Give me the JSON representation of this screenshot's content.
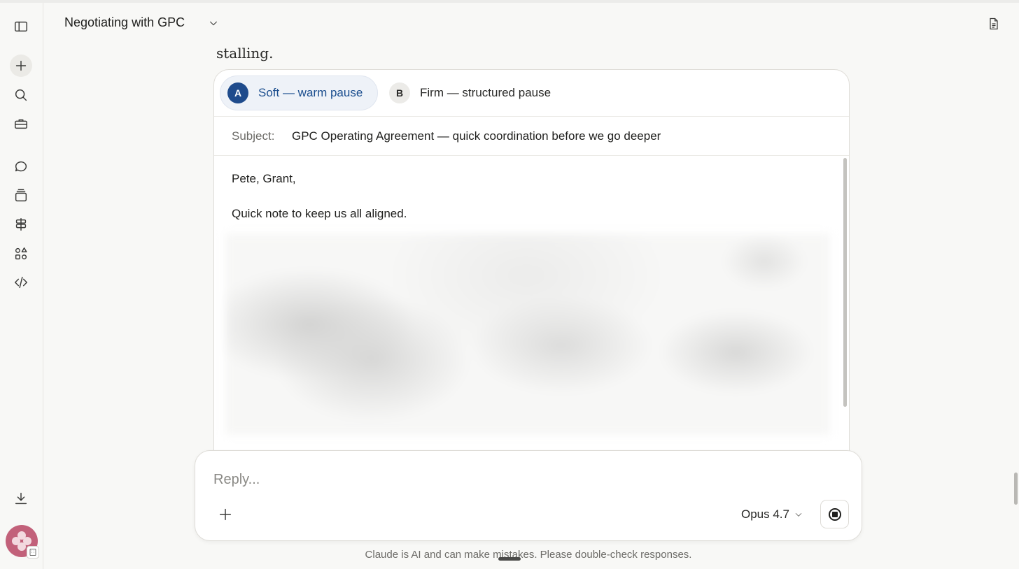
{
  "header": {
    "title": "Negotiating with GPC"
  },
  "sidebar": {
    "items": [
      {
        "name": "toggle-sidebar",
        "icon": "sidebar-icon"
      },
      {
        "name": "new-chat",
        "icon": "plus-icon"
      },
      {
        "name": "search",
        "icon": "search-icon"
      },
      {
        "name": "tools",
        "icon": "toolbox-icon"
      },
      {
        "name": "chats",
        "icon": "chat-icon"
      },
      {
        "name": "projects",
        "icon": "stack-icon"
      },
      {
        "name": "artifacts",
        "icon": "signpost-icon"
      },
      {
        "name": "apps",
        "icon": "shapes-icon"
      },
      {
        "name": "code",
        "icon": "code-icon"
      },
      {
        "name": "download",
        "icon": "download-icon"
      }
    ]
  },
  "message": {
    "trailing_text": "stalling."
  },
  "email": {
    "tabs": [
      {
        "letter": "A",
        "label": "Soft — warm pause",
        "selected": true
      },
      {
        "letter": "B",
        "label": "Firm — structured pause",
        "selected": false
      }
    ],
    "subject_label": "Subject:",
    "subject": "GPC Operating Agreement — quick coordination before we go deeper",
    "greeting": "Pete, Grant,",
    "line1": "Quick note to keep us all aligned."
  },
  "composer": {
    "placeholder": "Reply...",
    "model": "Opus 4.7"
  },
  "footer": {
    "disclaimer": "Claude is AI and can make mistakes. Please double-check responses."
  },
  "colors": {
    "accent": "#1e4b8c",
    "background": "#f8f8f6",
    "avatar": "#c2617a"
  }
}
